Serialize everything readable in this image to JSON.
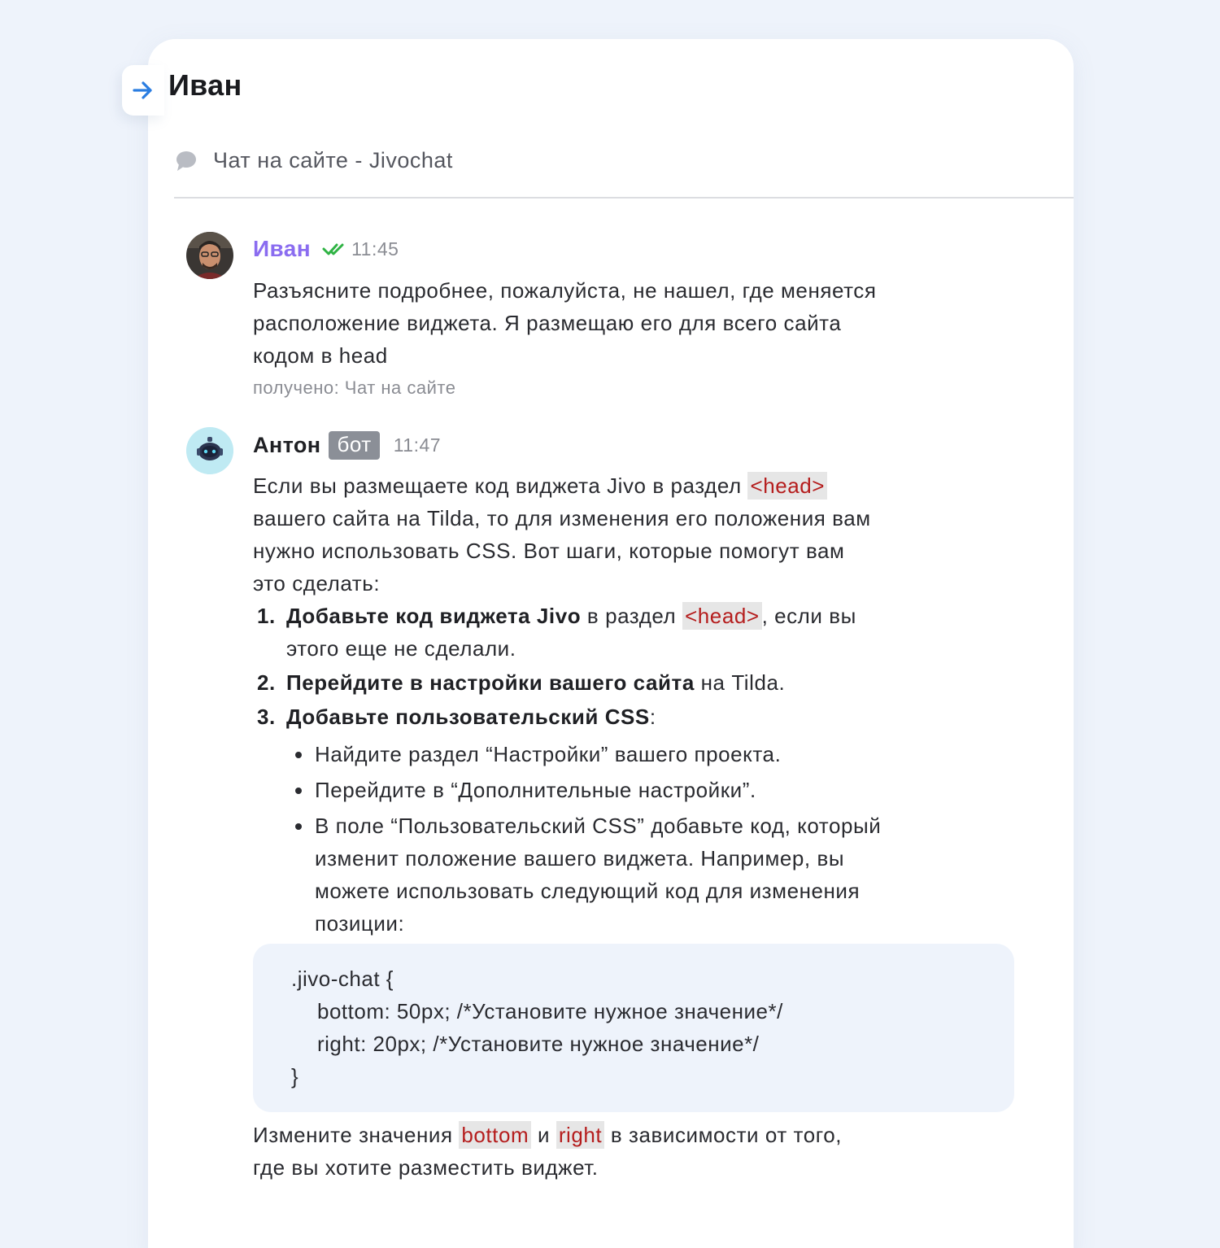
{
  "header": {
    "back_icon": "arrow-right-icon",
    "title": "Иван",
    "channel_icon": "chat-bubble-icon",
    "channel": "Чат на сайте - Jivochat"
  },
  "messages": {
    "client": {
      "name": "Иван",
      "status_icon": "double-check-icon",
      "time": "11:45",
      "text_lines": [
        "Разъясните подробнее, пожалуйста, не нашел, где меняется",
        "расположение виджета. Я размещаю его для всего сайта",
        "кодом в head"
      ],
      "received": "получено: Чат на сайте"
    },
    "bot": {
      "name": "Антон",
      "badge": "бот",
      "time": "11:47",
      "intro": {
        "line1_text": "Если вы размещаете код виджета Jivo в раздел ",
        "line1_code": "<head>",
        "line2": "вашего сайта на Tilda, то для изменения его положения вам",
        "line3": "нужно использовать CSS. Вот шаги, которые помогут вам",
        "line4": "это сделать:"
      },
      "steps": [
        {
          "num": "1.",
          "bold": "Добавьте код виджета Jivo",
          "text_a": " в раздел ",
          "code": "<head>",
          "text_b": ", если вы",
          "continuation": "этого еще не сделали."
        },
        {
          "num": "2.",
          "bold": "Перейдите в настройки вашего сайта",
          "text_a": " на Tilda."
        },
        {
          "num": "3.",
          "bold": "Добавьте пользовательский CSS",
          "text_a": ":"
        }
      ],
      "bullets": [
        {
          "lines": [
            "Найдите раздел “Настройки” вашего проекта."
          ]
        },
        {
          "lines": [
            "Перейдите в “Дополнительные настройки”."
          ]
        },
        {
          "lines": [
            "В поле “Пользовательский CSS” добавьте код, который",
            "изменит положение вашего виджета. Например, вы",
            "можете использовать следующий код для изменения",
            "позиции:"
          ]
        }
      ],
      "code_lines": [
        ".jivo-chat {",
        "bottom: 50px; /*Установите нужное значение*/",
        "right: 20px; /*Установите нужное значение*/",
        "}"
      ],
      "outro": {
        "text_a": "Измените значения ",
        "code_a": "bottom",
        "text_b": " и ",
        "code_b": "right",
        "text_c": " в зависимости от того,",
        "line2": "где вы хотите разместить виджет."
      }
    }
  },
  "colors": {
    "page_bg": "#eef3fb",
    "client_name": "#8a6cf0",
    "check": "#2fb344",
    "arrow": "#2a7de1",
    "code_text": "#b51d1d",
    "code_bg": "#e6e6e6",
    "bot_badge": "#8b8f97"
  }
}
